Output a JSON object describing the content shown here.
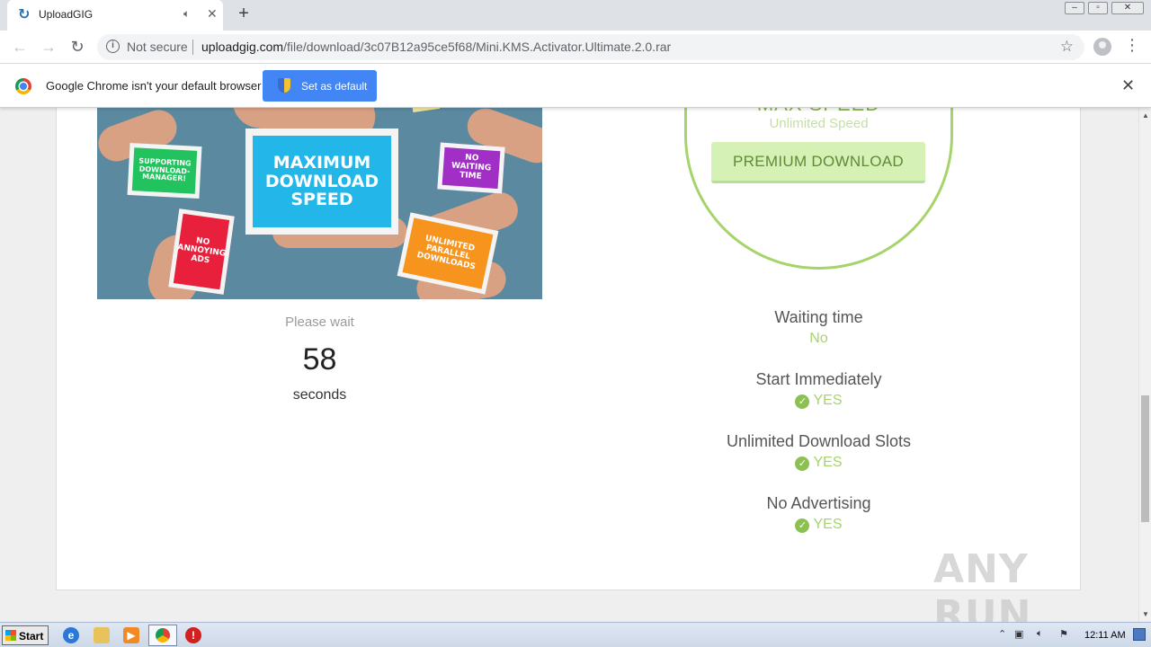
{
  "browser": {
    "tab": {
      "title": "UploadGIG"
    },
    "window_controls": [
      "–",
      "▫",
      "✕"
    ],
    "address": {
      "security": "Not secure",
      "host": "uploadgig.com",
      "path": "/file/download/3c07B12a95ce5f68/Mini.KMS.Activator.Ultimate.2.0.rar"
    }
  },
  "infobar": {
    "message": "Google Chrome isn't your default browser",
    "button": "Set as default"
  },
  "promo": {
    "cards": {
      "max_speed": "MAXIMUM DOWNLOAD SPEED",
      "download_manager": "SUPPORTING DOWNLOAD-MANAGER!",
      "no_waiting": "NO WAITING TIME",
      "no_ads": "NO ANNOYING ADS",
      "parallel": "UNLIMITED PARALLEL DOWNLOADS"
    }
  },
  "countdown": {
    "label": "Please wait",
    "value": "58",
    "unit": "seconds"
  },
  "premium": {
    "heading": "MAX SPEED",
    "subheading": "Unlimited Speed",
    "button": "PREMIUM DOWNLOAD",
    "features": [
      {
        "title": "Waiting time",
        "value": "No"
      },
      {
        "title": "Start Immediately",
        "value": "YES"
      },
      {
        "title": "Unlimited Download Slots",
        "value": "YES"
      },
      {
        "title": "No Advertising",
        "value": "YES"
      }
    ]
  },
  "watermark": "ANY RUN",
  "taskbar": {
    "start": "Start",
    "clock": "12:11 AM"
  },
  "colors": {
    "accent_green": "#a6d46b",
    "chrome_blue": "#4285f4",
    "promo_bg": "#5b8aa0"
  }
}
